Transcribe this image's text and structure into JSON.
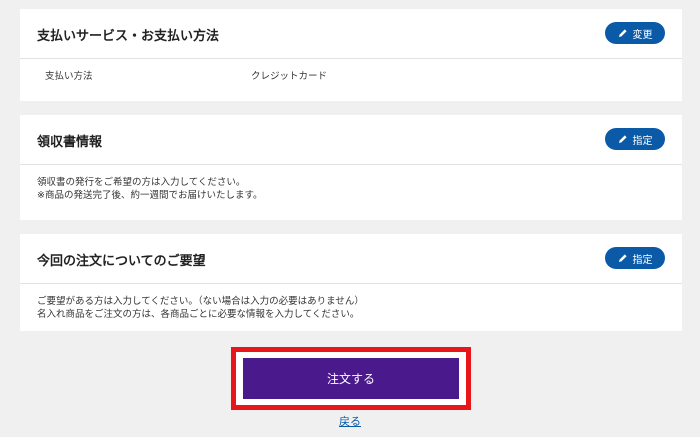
{
  "payment": {
    "title": "支払いサービス・お支払い方法",
    "button_label": "変更",
    "method_label": "支払い方法",
    "method_value": "クレジットカード"
  },
  "receipt": {
    "title": "領収書情報",
    "button_label": "指定",
    "line1": "領収書の発行をご希望の方は入力してください。",
    "line2": "※商品の発送完了後、約一週間でお届けいたします。"
  },
  "request": {
    "title": "今回の注文についてのご要望",
    "button_label": "指定",
    "line1": "ご要望がある方は入力してください。（ない場合は入力の必要はありません）",
    "line2": "名入れ商品をご注文の方は、各商品ごとに必要な情報を入力してください。"
  },
  "order_button": "注文する",
  "back_link": "戻る",
  "colors": {
    "accent": "#0a5aa8",
    "order_button": "#4a1a8c",
    "highlight_border": "#e8151b",
    "background": "#f0f0f0"
  },
  "icons": {
    "edit": "pencil-icon"
  }
}
